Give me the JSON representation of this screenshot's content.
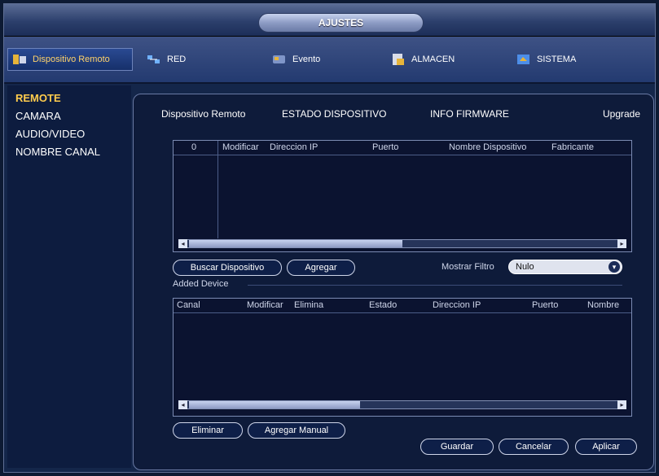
{
  "window": {
    "title": "AJUSTES"
  },
  "topnav": [
    {
      "label": "Dispositivo Remoto",
      "icon": "remote-device-icon"
    },
    {
      "label": "RED",
      "icon": "network-icon"
    },
    {
      "label": "Evento",
      "icon": "event-icon"
    },
    {
      "label": "ALMACEN",
      "icon": "storage-icon"
    },
    {
      "label": "SISTEMA",
      "icon": "system-icon"
    }
  ],
  "sidebar": {
    "items": [
      {
        "label": "REMOTE"
      },
      {
        "label": "CAMARA"
      },
      {
        "label": "AUDIO/VIDEO"
      },
      {
        "label": "NOMBRE CANAL"
      }
    ]
  },
  "tabs": [
    {
      "label": "Dispositivo Remoto"
    },
    {
      "label": "ESTADO DISPOSITIVO"
    },
    {
      "label": "INFO FIRMWARE"
    },
    {
      "label": "Upgrade"
    }
  ],
  "search_table": {
    "columns": [
      "0",
      "Modificar",
      "Direccion IP",
      "Puerto",
      "Nombre Dispositivo",
      "Fabricante"
    ]
  },
  "search_actions": {
    "search_label": "Buscar Dispositivo",
    "add_label": "Agregar",
    "filter_label": "Mostrar Filtro",
    "filter_value": "Nulo"
  },
  "added_section": {
    "title": "Added Device"
  },
  "added_table": {
    "columns": [
      "Canal",
      "Modificar",
      "Elimina",
      "Estado",
      "Direccion IP",
      "Puerto",
      "Nombre"
    ]
  },
  "bottom_actions": {
    "delete_label": "Eliminar",
    "manual_add_label": "Agregar Manual",
    "save_label": "Guardar",
    "cancel_label": "Cancelar",
    "apply_label": "Aplicar"
  },
  "scroll": {
    "search_thumb": 0.5,
    "added_thumb": 0.4
  },
  "colors": {
    "accent": "#ffcc4d",
    "background": "#14264a"
  }
}
